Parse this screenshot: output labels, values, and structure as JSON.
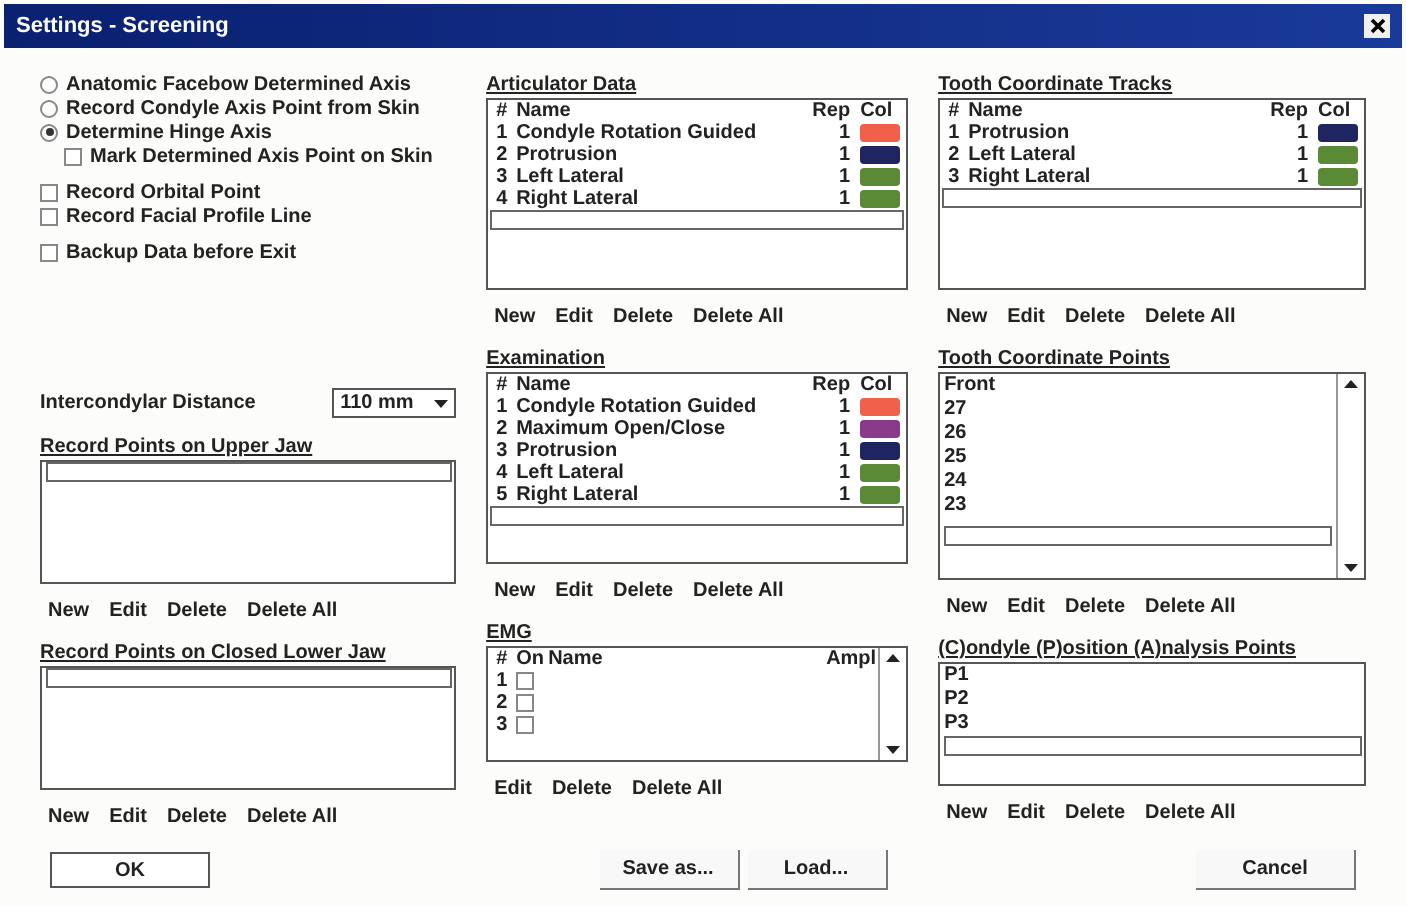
{
  "window": {
    "title": "Settings - Screening"
  },
  "option_groups": [
    {
      "items": [
        {
          "kind": "radio",
          "label": "Anatomic Facebow Determined Axis",
          "selected": false
        },
        {
          "kind": "radio",
          "label": "Record Condyle Axis Point from Skin",
          "selected": false
        },
        {
          "kind": "radio",
          "label": "Determine Hinge Axis",
          "selected": true,
          "children": [
            {
              "kind": "checkbox",
              "label": "Mark Determined Axis Point on Skin",
              "checked": false
            }
          ]
        }
      ]
    },
    {
      "items": [
        {
          "kind": "checkbox",
          "label": "Record Orbital Point",
          "checked": false
        },
        {
          "kind": "checkbox",
          "label": "Record Facial Profile Line",
          "checked": false
        }
      ]
    },
    {
      "items": [
        {
          "kind": "checkbox",
          "label": "Backup Data before Exit",
          "checked": false
        }
      ]
    }
  ],
  "intercondylar": {
    "label": "Intercondylar Distance",
    "value": "110 mm"
  },
  "left_panels": [
    {
      "kind": "list",
      "title": "Record Points on Upper Jaw",
      "actions": [
        "New",
        "Edit",
        "Delete",
        "Delete All"
      ]
    },
    {
      "kind": "list",
      "title": "Record Points on Closed Lower Jaw",
      "actions": [
        "New",
        "Edit",
        "Delete",
        "Delete All"
      ]
    }
  ],
  "middle_panels": [
    {
      "kind": "tracks",
      "title": "Articulator Data",
      "columns": [
        "#",
        "Name",
        "Rep",
        "Col"
      ],
      "rows": [
        {
          "index": "1",
          "name": "Condyle Rotation Guided",
          "rep": "1",
          "color": "#f0604a"
        },
        {
          "index": "2",
          "name": "Protrusion",
          "rep": "1",
          "color": "#1f2560"
        },
        {
          "index": "3",
          "name": "Left Lateral",
          "rep": "1",
          "color": "#5a8a36"
        },
        {
          "index": "4",
          "name": "Right Lateral",
          "rep": "1",
          "color": "#5a8a36"
        }
      ],
      "actions": [
        "New",
        "Edit",
        "Delete",
        "Delete All"
      ]
    },
    {
      "kind": "tracks",
      "title": "Examination",
      "columns": [
        "#",
        "Name",
        "Rep",
        "Col"
      ],
      "rows": [
        {
          "index": "1",
          "name": "Condyle Rotation Guided",
          "rep": "1",
          "color": "#f0604a"
        },
        {
          "index": "2",
          "name": "Maximum Open/Close",
          "rep": "1",
          "color": "#8a3a8a"
        },
        {
          "index": "3",
          "name": "Protrusion",
          "rep": "1",
          "color": "#1f2560"
        },
        {
          "index": "4",
          "name": "Left Lateral",
          "rep": "1",
          "color": "#5a8a36"
        },
        {
          "index": "5",
          "name": "Right Lateral",
          "rep": "1",
          "color": "#5a8a36"
        }
      ],
      "actions": [
        "New",
        "Edit",
        "Delete",
        "Delete All"
      ]
    },
    {
      "kind": "emg",
      "title": "EMG",
      "columns": [
        "#",
        "On",
        "Name",
        "Ampl"
      ],
      "rows": [
        {
          "index": "1",
          "on": false
        },
        {
          "index": "2",
          "on": false
        },
        {
          "index": "3",
          "on": false
        }
      ],
      "actions": [
        "Edit",
        "Delete",
        "Delete All"
      ]
    }
  ],
  "right_panels": [
    {
      "kind": "tracks",
      "title": "Tooth Coordinate Tracks",
      "columns": [
        "#",
        "Name",
        "Rep",
        "Col"
      ],
      "rows": [
        {
          "index": "1",
          "name": "Protrusion",
          "rep": "1",
          "color": "#1f2560"
        },
        {
          "index": "2",
          "name": "Left Lateral",
          "rep": "1",
          "color": "#5a8a36"
        },
        {
          "index": "3",
          "name": "Right Lateral",
          "rep": "1",
          "color": "#5a8a36"
        }
      ],
      "actions": [
        "New",
        "Edit",
        "Delete",
        "Delete All"
      ]
    },
    {
      "kind": "scroll_list",
      "title": "Tooth Coordinate Points",
      "rows": [
        "Front",
        "27",
        "26",
        "25",
        "24",
        "23"
      ],
      "actions": [
        "New",
        "Edit",
        "Delete",
        "Delete All"
      ]
    },
    {
      "kind": "list",
      "title": "(C)ondyle (P)osition (A)nalysis Points",
      "rows": [
        "P1",
        "P2",
        "P3"
      ],
      "actions": [
        "New",
        "Edit",
        "Delete",
        "Delete All"
      ]
    }
  ],
  "buttons": [
    {
      "kind": "ok",
      "label": "OK"
    },
    {
      "kind": "middle",
      "label": "Save as..."
    },
    {
      "kind": "middle",
      "label": "Load..."
    },
    {
      "kind": "cancel",
      "label": "Cancel"
    }
  ]
}
